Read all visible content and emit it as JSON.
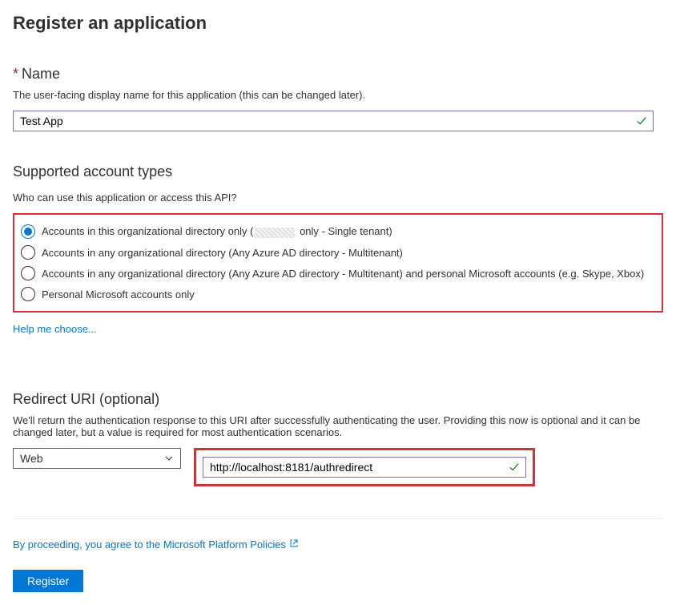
{
  "page": {
    "title": "Register an application"
  },
  "name": {
    "label": "Name",
    "description": "The user-facing display name for this application (this can be changed later).",
    "value": "Test App"
  },
  "accountTypes": {
    "label": "Supported account types",
    "question": "Who can use this application or access this API?",
    "options": [
      {
        "label_pre": "Accounts in this organizational directory only (",
        "label_post": " only - Single tenant)",
        "selected": true,
        "blurred": true
      },
      {
        "label": "Accounts in any organizational directory (Any Azure AD directory - Multitenant)",
        "selected": false
      },
      {
        "label": "Accounts in any organizational directory (Any Azure AD directory - Multitenant) and personal Microsoft accounts (e.g. Skype, Xbox)",
        "selected": false
      },
      {
        "label": "Personal Microsoft accounts only",
        "selected": false
      }
    ],
    "helpLink": "Help me choose..."
  },
  "redirect": {
    "label": "Redirect URI (optional)",
    "description": "We'll return the authentication response to this URI after successfully authenticating the user. Providing this now is optional and it can be changed later, but a value is required for most authentication scenarios.",
    "platform": "Web",
    "uri": "http://localhost:8181/authredirect"
  },
  "footer": {
    "agreement_prefix": "By proceeding, you agree to the ",
    "agreement_link": "Microsoft Platform Policies",
    "register": "Register"
  }
}
